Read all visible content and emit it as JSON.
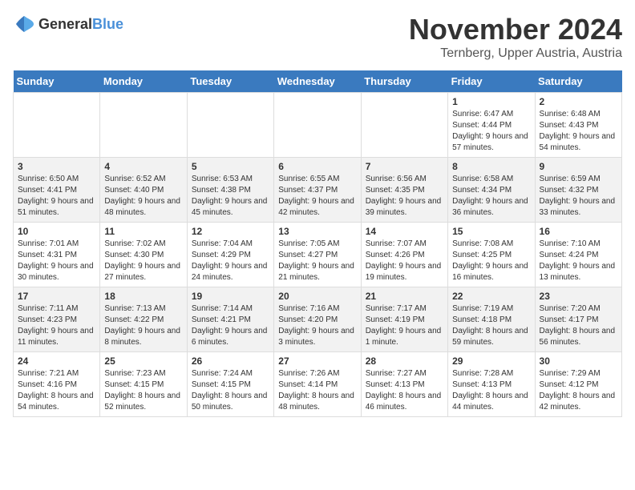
{
  "logo": {
    "general": "General",
    "blue": "Blue"
  },
  "title": "November 2024",
  "location": "Ternberg, Upper Austria, Austria",
  "days_of_week": [
    "Sunday",
    "Monday",
    "Tuesday",
    "Wednesday",
    "Thursday",
    "Friday",
    "Saturday"
  ],
  "weeks": [
    [
      {
        "day": "",
        "info": ""
      },
      {
        "day": "",
        "info": ""
      },
      {
        "day": "",
        "info": ""
      },
      {
        "day": "",
        "info": ""
      },
      {
        "day": "",
        "info": ""
      },
      {
        "day": "1",
        "info": "Sunrise: 6:47 AM\nSunset: 4:44 PM\nDaylight: 9 hours and 57 minutes."
      },
      {
        "day": "2",
        "info": "Sunrise: 6:48 AM\nSunset: 4:43 PM\nDaylight: 9 hours and 54 minutes."
      }
    ],
    [
      {
        "day": "3",
        "info": "Sunrise: 6:50 AM\nSunset: 4:41 PM\nDaylight: 9 hours and 51 minutes."
      },
      {
        "day": "4",
        "info": "Sunrise: 6:52 AM\nSunset: 4:40 PM\nDaylight: 9 hours and 48 minutes."
      },
      {
        "day": "5",
        "info": "Sunrise: 6:53 AM\nSunset: 4:38 PM\nDaylight: 9 hours and 45 minutes."
      },
      {
        "day": "6",
        "info": "Sunrise: 6:55 AM\nSunset: 4:37 PM\nDaylight: 9 hours and 42 minutes."
      },
      {
        "day": "7",
        "info": "Sunrise: 6:56 AM\nSunset: 4:35 PM\nDaylight: 9 hours and 39 minutes."
      },
      {
        "day": "8",
        "info": "Sunrise: 6:58 AM\nSunset: 4:34 PM\nDaylight: 9 hours and 36 minutes."
      },
      {
        "day": "9",
        "info": "Sunrise: 6:59 AM\nSunset: 4:32 PM\nDaylight: 9 hours and 33 minutes."
      }
    ],
    [
      {
        "day": "10",
        "info": "Sunrise: 7:01 AM\nSunset: 4:31 PM\nDaylight: 9 hours and 30 minutes."
      },
      {
        "day": "11",
        "info": "Sunrise: 7:02 AM\nSunset: 4:30 PM\nDaylight: 9 hours and 27 minutes."
      },
      {
        "day": "12",
        "info": "Sunrise: 7:04 AM\nSunset: 4:29 PM\nDaylight: 9 hours and 24 minutes."
      },
      {
        "day": "13",
        "info": "Sunrise: 7:05 AM\nSunset: 4:27 PM\nDaylight: 9 hours and 21 minutes."
      },
      {
        "day": "14",
        "info": "Sunrise: 7:07 AM\nSunset: 4:26 PM\nDaylight: 9 hours and 19 minutes."
      },
      {
        "day": "15",
        "info": "Sunrise: 7:08 AM\nSunset: 4:25 PM\nDaylight: 9 hours and 16 minutes."
      },
      {
        "day": "16",
        "info": "Sunrise: 7:10 AM\nSunset: 4:24 PM\nDaylight: 9 hours and 13 minutes."
      }
    ],
    [
      {
        "day": "17",
        "info": "Sunrise: 7:11 AM\nSunset: 4:23 PM\nDaylight: 9 hours and 11 minutes."
      },
      {
        "day": "18",
        "info": "Sunrise: 7:13 AM\nSunset: 4:22 PM\nDaylight: 9 hours and 8 minutes."
      },
      {
        "day": "19",
        "info": "Sunrise: 7:14 AM\nSunset: 4:21 PM\nDaylight: 9 hours and 6 minutes."
      },
      {
        "day": "20",
        "info": "Sunrise: 7:16 AM\nSunset: 4:20 PM\nDaylight: 9 hours and 3 minutes."
      },
      {
        "day": "21",
        "info": "Sunrise: 7:17 AM\nSunset: 4:19 PM\nDaylight: 9 hours and 1 minute."
      },
      {
        "day": "22",
        "info": "Sunrise: 7:19 AM\nSunset: 4:18 PM\nDaylight: 8 hours and 59 minutes."
      },
      {
        "day": "23",
        "info": "Sunrise: 7:20 AM\nSunset: 4:17 PM\nDaylight: 8 hours and 56 minutes."
      }
    ],
    [
      {
        "day": "24",
        "info": "Sunrise: 7:21 AM\nSunset: 4:16 PM\nDaylight: 8 hours and 54 minutes."
      },
      {
        "day": "25",
        "info": "Sunrise: 7:23 AM\nSunset: 4:15 PM\nDaylight: 8 hours and 52 minutes."
      },
      {
        "day": "26",
        "info": "Sunrise: 7:24 AM\nSunset: 4:15 PM\nDaylight: 8 hours and 50 minutes."
      },
      {
        "day": "27",
        "info": "Sunrise: 7:26 AM\nSunset: 4:14 PM\nDaylight: 8 hours and 48 minutes."
      },
      {
        "day": "28",
        "info": "Sunrise: 7:27 AM\nSunset: 4:13 PM\nDaylight: 8 hours and 46 minutes."
      },
      {
        "day": "29",
        "info": "Sunrise: 7:28 AM\nSunset: 4:13 PM\nDaylight: 8 hours and 44 minutes."
      },
      {
        "day": "30",
        "info": "Sunrise: 7:29 AM\nSunset: 4:12 PM\nDaylight: 8 hours and 42 minutes."
      }
    ]
  ]
}
